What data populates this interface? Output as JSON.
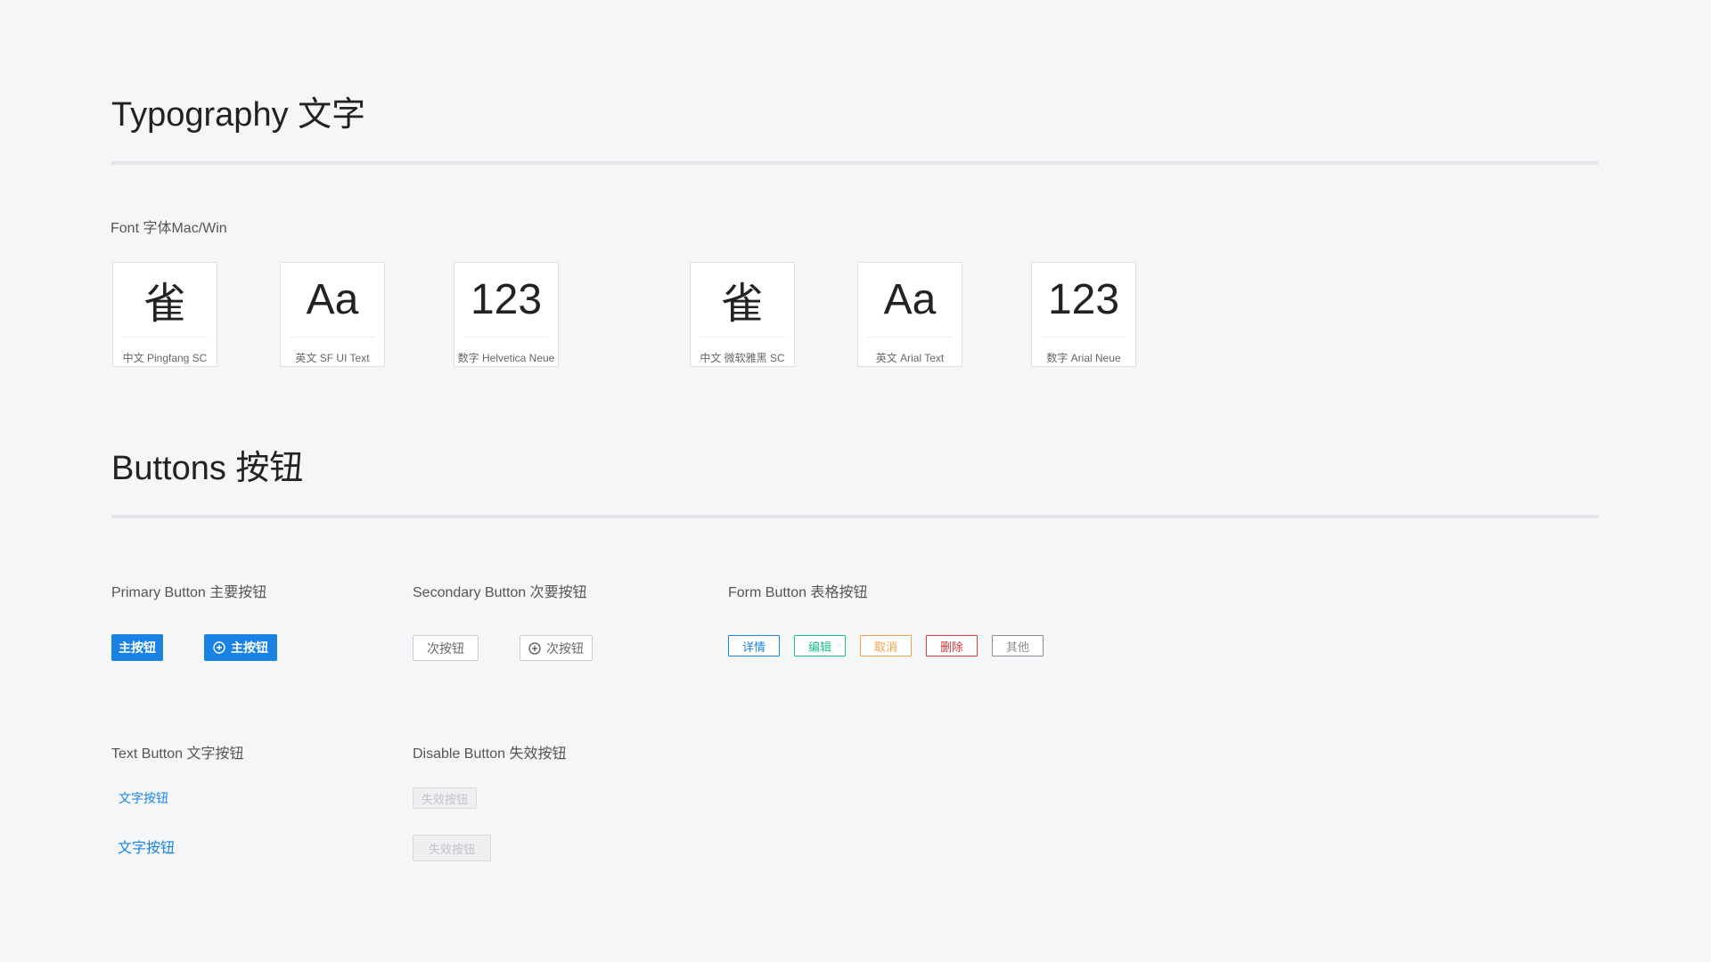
{
  "typography": {
    "title": "Typography 文字",
    "font_label": "Font 字体Mac/Win",
    "cards": [
      {
        "glyph": "雀",
        "caption": "中文 Pingfang SC"
      },
      {
        "glyph": "Aa",
        "caption": "英文 SF UI Text"
      },
      {
        "glyph": "123",
        "caption": "数字 Helvetica Neue"
      },
      {
        "glyph": "雀",
        "caption": "中文 微软雅黑 SC"
      },
      {
        "glyph": "Aa",
        "caption": "英文 Arial Text"
      },
      {
        "glyph": "123",
        "caption": "数字 Arial Neue"
      }
    ]
  },
  "buttons": {
    "title": "Buttons 按钮",
    "primary": {
      "label": "Primary Button 主要按钮",
      "btn1": "主按钮",
      "btn2": "主按钮",
      "color": "#1a82e3"
    },
    "secondary": {
      "label": "Secondary Button 次要按钮",
      "btn1": "次按钮",
      "btn2": "次按钮"
    },
    "form": {
      "label": "Form Button 表格按钮",
      "items": [
        {
          "text": "详情",
          "color": "#1a82e3"
        },
        {
          "text": "编辑",
          "color": "#19be8c"
        },
        {
          "text": "取消",
          "color": "#f5a04a"
        },
        {
          "text": "删除",
          "color": "#e0363b"
        },
        {
          "text": "其他",
          "color": "#8a8d92"
        }
      ]
    },
    "text": {
      "label": "Text Button 文字按钮",
      "btn1": "文字按钮",
      "btn2": "文字按钮"
    },
    "disabled": {
      "label": "Disable Button 失效按钮",
      "btn1": "失效按钮",
      "btn2": "失效按钮"
    }
  }
}
